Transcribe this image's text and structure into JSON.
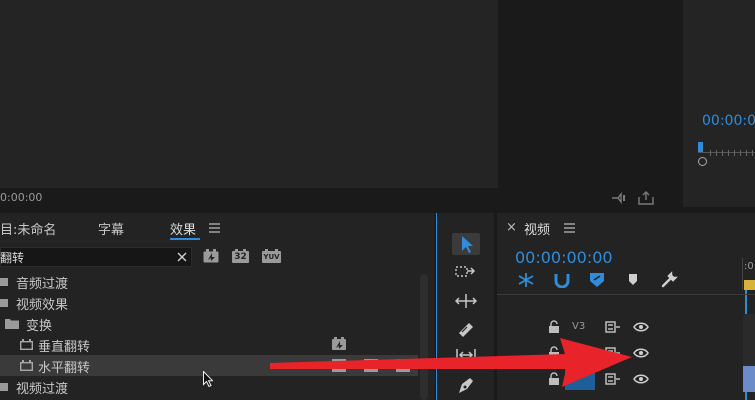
{
  "source_monitor": {
    "timecode": "0:00:00"
  },
  "program_monitor": {
    "timecode": "00:00:0"
  },
  "project_panel": {
    "tabs": [
      {
        "label": "目:未命名"
      },
      {
        "label": "字幕"
      },
      {
        "label": "效果"
      }
    ],
    "active_tab": "效果",
    "menu_icon": "hamburger-menu-icon",
    "search": {
      "value": "翻转"
    },
    "toggle_icons": [
      "accelerated-effects-icon",
      "32-bit-icon",
      "yuv-icon"
    ],
    "badges": {
      "b32": "32",
      "yuv": "YUV"
    },
    "tree": [
      {
        "label": "音频过渡",
        "icon": "folder-icon"
      },
      {
        "label": "视频效果",
        "icon": "folder-icon"
      },
      {
        "label": "变换",
        "icon": "folder-open-icon"
      },
      {
        "label": "垂直翻转",
        "icon": "effect-icon"
      },
      {
        "label": "水平翻转",
        "icon": "effect-icon",
        "selected": true
      },
      {
        "label": "视频过渡",
        "icon": "folder-icon"
      }
    ]
  },
  "tools": [
    "selection-tool-icon",
    "track-select-tool-icon",
    "ripple-edit-tool-icon",
    "razor-tool-icon",
    "slip-tool-icon",
    "pen-tool-icon"
  ],
  "timeline": {
    "close_label": "×",
    "sequence_name": "视频",
    "timecode": "00:00:00:00",
    "toolbar_icons": [
      "snap-icon",
      "linked-selection-icon",
      "add-marker-icon",
      "marker-icon",
      "wrench-icon"
    ],
    "ruler_start": ":0",
    "tracks": [
      {
        "name": "V3",
        "lock": "lock-icon",
        "sync": "sync-lock-icon",
        "eye": "eye-icon"
      },
      {
        "name": "",
        "lock": "lock-icon",
        "sync": "sync-lock-icon",
        "eye": "eye-icon"
      },
      {
        "name": "",
        "lock": "lock-icon",
        "sync": "sync-lock-icon",
        "eye": "eye-icon"
      }
    ]
  },
  "colors": {
    "accent": "#2f8cdb",
    "arrow": "#e8232a",
    "panel": "#232323",
    "bg": "#1a1a1a"
  }
}
